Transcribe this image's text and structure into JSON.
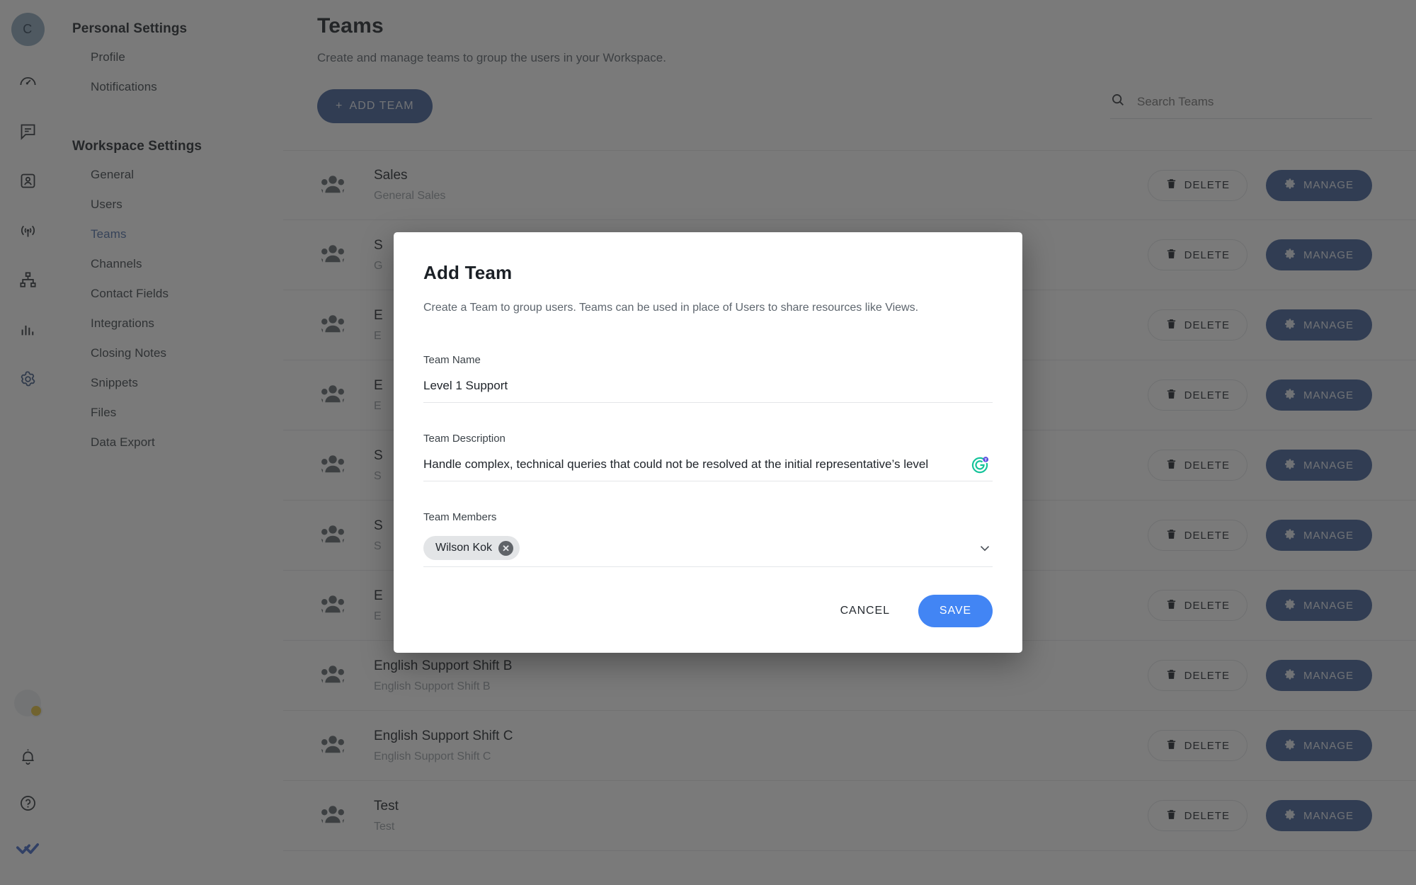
{
  "rail": {
    "avatar_initial": "C",
    "icons": [
      {
        "name": "speedometer-icon"
      },
      {
        "name": "chat-icon"
      },
      {
        "name": "contact-card-icon"
      },
      {
        "name": "broadcast-icon"
      },
      {
        "name": "org-chart-icon"
      },
      {
        "name": "bar-chart-icon"
      },
      {
        "name": "gear-icon"
      }
    ],
    "bottom_icons": [
      {
        "name": "bell-icon"
      },
      {
        "name": "help-icon"
      },
      {
        "name": "double-check-logo"
      }
    ]
  },
  "nav": {
    "personal_heading": "Personal Settings",
    "personal_items": [
      "Profile",
      "Notifications"
    ],
    "workspace_heading": "Workspace Settings",
    "workspace_items": [
      "General",
      "Users",
      "Teams",
      "Channels",
      "Contact Fields",
      "Integrations",
      "Closing Notes",
      "Snippets",
      "Files",
      "Data Export"
    ],
    "active_item": "Teams"
  },
  "page": {
    "title": "Teams",
    "subtitle": "Create and manage teams to group the users in your Workspace.",
    "add_team_label": "ADD TEAM",
    "add_team_plus": "+",
    "search_placeholder": "Search Teams",
    "search_value": "",
    "delete_label": "DELETE",
    "manage_label": "MANAGE"
  },
  "teams": [
    {
      "name": "Sales",
      "description": "General Sales"
    },
    {
      "name": "S",
      "description": "G"
    },
    {
      "name": "E",
      "description": "E"
    },
    {
      "name": "E",
      "description": "E"
    },
    {
      "name": "S",
      "description": "S"
    },
    {
      "name": "S",
      "description": "S"
    },
    {
      "name": "E",
      "description": "E"
    },
    {
      "name": "English Support Shift B",
      "description": "English Support Shift B"
    },
    {
      "name": "English Support Shift C",
      "description": "English Support Shift C"
    },
    {
      "name": "Test",
      "description": "Test"
    }
  ],
  "modal": {
    "title": "Add Team",
    "subtitle": "Create a Team to group users. Teams can be used in place of Users to share resources like Views.",
    "team_name_label": "Team Name",
    "team_name_value": "Level 1 Support",
    "team_description_label": "Team Description",
    "team_description_value": "Handle complex, technical queries that could not be resolved at the initial representative’s level",
    "team_members_label": "Team Members",
    "member_chip": "Wilson Kok",
    "chip_remove": "✕",
    "cancel_label": "CANCEL",
    "save_label": "SAVE"
  },
  "colors": {
    "primary_blue": "#3f6099",
    "save_blue": "#4285f4",
    "accent_nav": "#4d6ea8",
    "scrim": "rgba(40,40,40,0.62)"
  }
}
